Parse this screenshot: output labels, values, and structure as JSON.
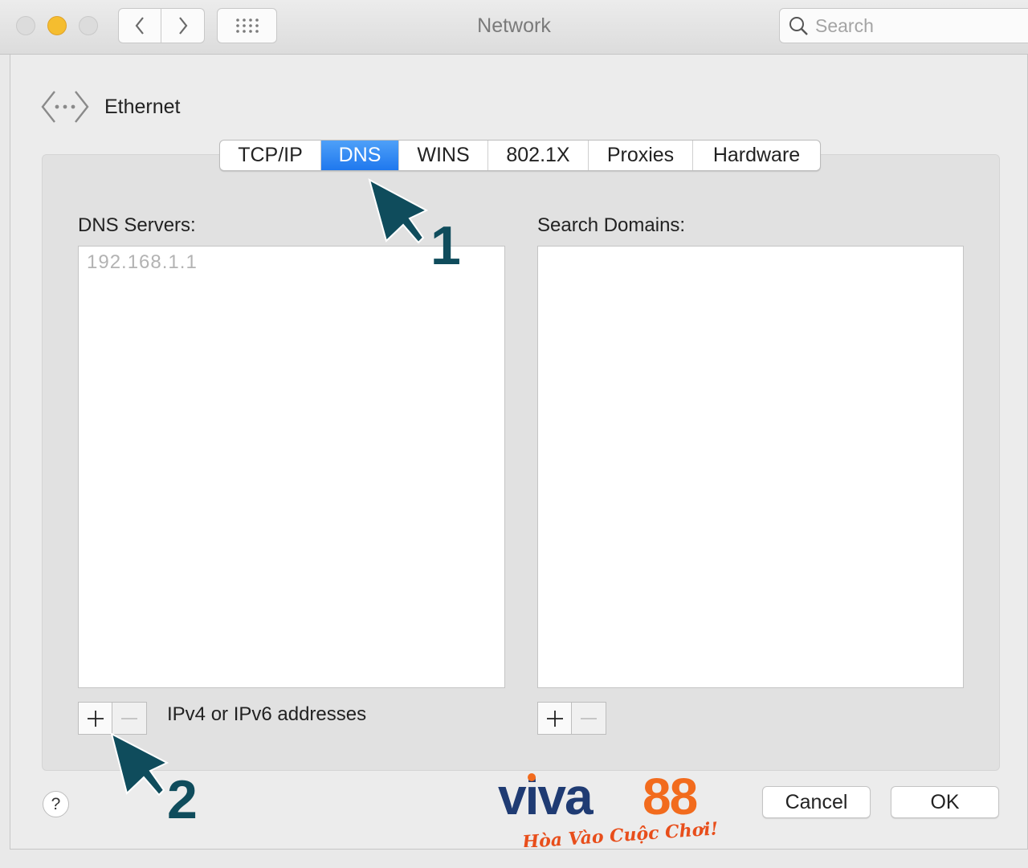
{
  "window": {
    "title": "Network"
  },
  "toolbar": {
    "search_placeholder": "Search"
  },
  "header": {
    "service": "Ethernet"
  },
  "tabs": [
    {
      "label": "TCP/IP",
      "active": false
    },
    {
      "label": "DNS",
      "active": true
    },
    {
      "label": "WINS",
      "active": false
    },
    {
      "label": "802.1X",
      "active": false
    },
    {
      "label": "Proxies",
      "active": false
    },
    {
      "label": "Hardware",
      "active": false
    }
  ],
  "dns": {
    "label": "DNS Servers:",
    "servers": [
      "192.168.1.1"
    ],
    "hint": "IPv4 or IPv6 addresses"
  },
  "search_domains": {
    "label": "Search Domains:",
    "items": []
  },
  "controls": {
    "add": "+",
    "remove": "−"
  },
  "footer": {
    "help": "?",
    "cancel": "Cancel",
    "ok": "OK"
  },
  "annotations": {
    "step1": "1",
    "step2": "2"
  },
  "watermark": {
    "brand": "VIVA88",
    "tagline": "Hòa Vào Cuộc Chơi!"
  },
  "colors": {
    "tab_active": "#2a7ff0",
    "arrow": "#0f4c5c",
    "brand_blue": "#1f3b73",
    "brand_orange": "#f26b1d"
  }
}
